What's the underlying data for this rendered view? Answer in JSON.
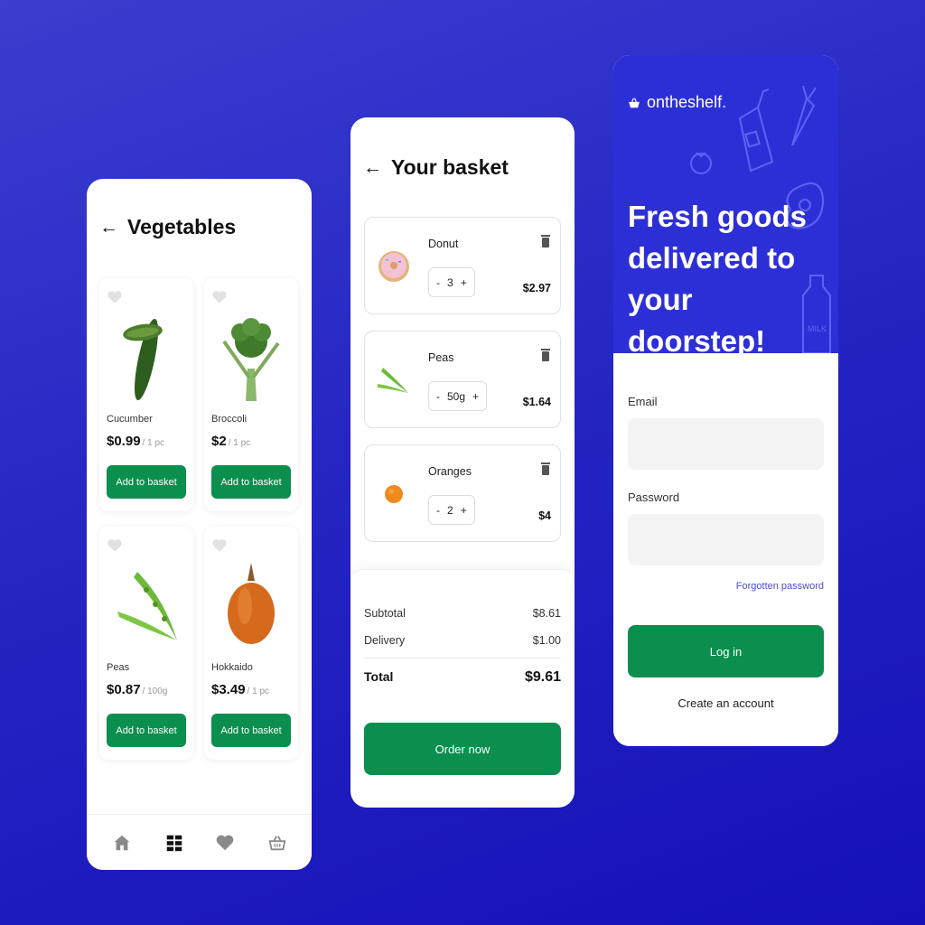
{
  "colors": {
    "accent_green": "#0a8f4e",
    "brand_blue": "#2d2fd6",
    "background": "#2626c4"
  },
  "vegetables": {
    "title": "Vegetables",
    "products": [
      {
        "name": "Cucumber",
        "price": "$0.99",
        "unit": "/ 1 pc",
        "button": "Add to basket",
        "icon": "cucumber-image"
      },
      {
        "name": "Broccoli",
        "price": "$2",
        "unit": "/ 1 pc",
        "button": "Add to basket",
        "icon": "broccoli-image"
      },
      {
        "name": "Peas",
        "price": "$0.87",
        "unit": "/ 100g",
        "button": "Add to basket",
        "icon": "peas-image"
      },
      {
        "name": "Hokkaido",
        "price": "$3.49",
        "unit": "/ 1 pc",
        "button": "Add to basket",
        "icon": "hokkaido-image"
      }
    ],
    "tabs": [
      {
        "icon": "home-icon"
      },
      {
        "icon": "grid-icon",
        "active": true
      },
      {
        "icon": "heart-icon"
      },
      {
        "icon": "basket-icon"
      }
    ]
  },
  "basket": {
    "title": "Your basket",
    "items": [
      {
        "name": "Donut",
        "qty": "3",
        "price": "$2.97",
        "minus": "-",
        "plus": "+"
      },
      {
        "name": "Peas",
        "qty": "50g",
        "price": "$1.64",
        "minus": "-",
        "plus": "+"
      },
      {
        "name": "Oranges",
        "qty": "2",
        "price": "$4",
        "minus": "-",
        "plus": "+"
      }
    ],
    "subtotal_label": "Subtotal",
    "subtotal": "$8.61",
    "delivery_label": "Delivery",
    "delivery": "$1.00",
    "total_label": "Total",
    "total": "$9.61",
    "order_button": "Order now"
  },
  "login": {
    "brand": "ontheshelf.",
    "tagline_1": "Fresh goods",
    "tagline_2": "delivered to",
    "tagline_3": "your doorstep!",
    "email_label": "Email",
    "email_value": "",
    "password_label": "Password",
    "password_value": "",
    "forgot": "Forgotten password",
    "login_button": "Log in",
    "create_account": "Create an account",
    "milk_label": "MILK"
  }
}
